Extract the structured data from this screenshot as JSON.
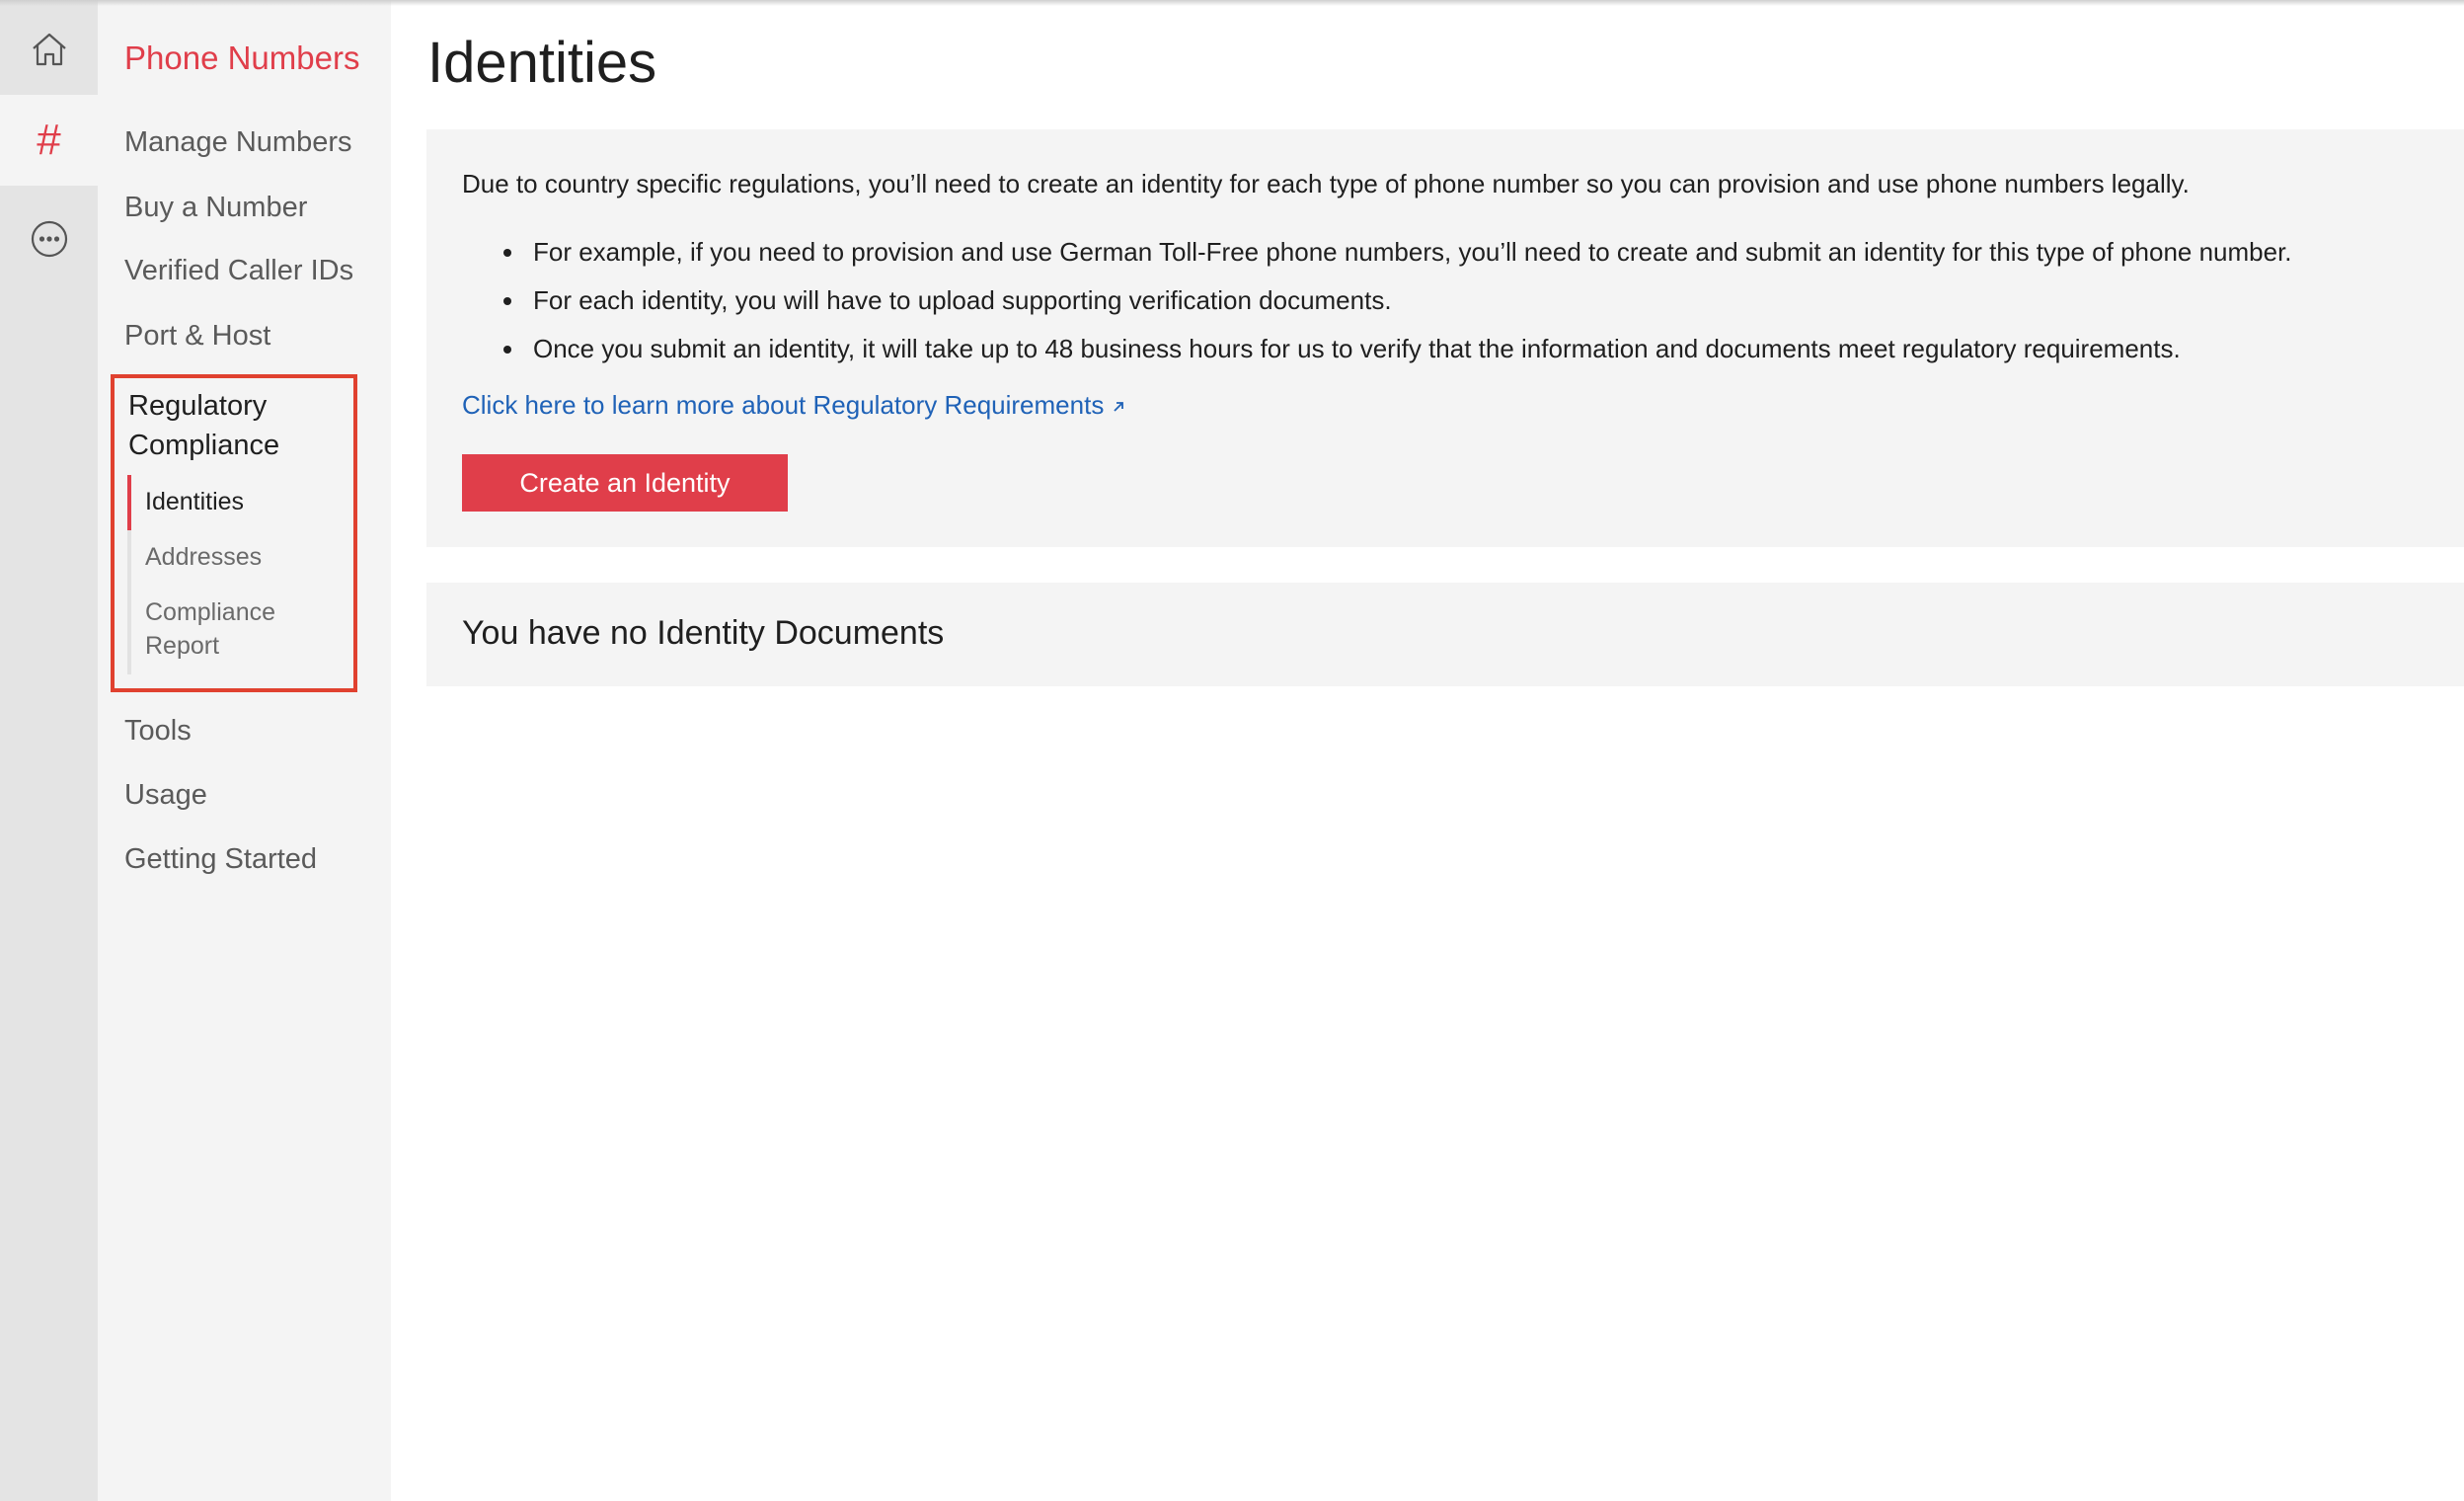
{
  "rail": {
    "items": [
      {
        "icon": "home-icon",
        "active": false
      },
      {
        "icon": "hash-icon",
        "glyph": "#",
        "active": true
      },
      {
        "icon": "more-icon",
        "active": false
      }
    ]
  },
  "sidebar": {
    "title": "Phone Numbers",
    "items": [
      {
        "label": "Manage Numbers"
      },
      {
        "label": "Buy a Number"
      },
      {
        "label": "Verified Caller IDs"
      },
      {
        "label": "Port & Host"
      }
    ],
    "regulatory": {
      "title": "Regulatory Compliance",
      "items": [
        {
          "label": "Identities",
          "active": true
        },
        {
          "label": "Addresses"
        },
        {
          "label": "Compliance Report"
        }
      ]
    },
    "bottom_items": [
      {
        "label": "Tools"
      },
      {
        "label": "Usage"
      },
      {
        "label": "Getting Started"
      }
    ]
  },
  "main": {
    "title": "Identities",
    "intro": "Due to country specific regulations, you’ll need to create an identity for each type of phone number so you can provision and use phone numbers legally.",
    "bullets": [
      "For example, if you need to provision and use German Toll-Free phone numbers, you’ll need to create and submit an identity for this type of phone number.",
      "For each identity, you will have to upload supporting verification documents.",
      "Once you submit an identity, it will take up to 48 business hours for us to verify that the information and documents meet regulatory requirements."
    ],
    "learn_link": "Click here to learn more about Regulatory Requirements",
    "create_button": "Create an Identity",
    "empty_message": "You have no Identity Documents"
  },
  "colors": {
    "accent": "#e03e4a",
    "highlight_border": "#e0412f",
    "link": "#1f62b7",
    "rail_bg": "#e4e4e4",
    "sidebar_bg": "#f4f4f4",
    "panel_bg": "#f4f4f4"
  }
}
